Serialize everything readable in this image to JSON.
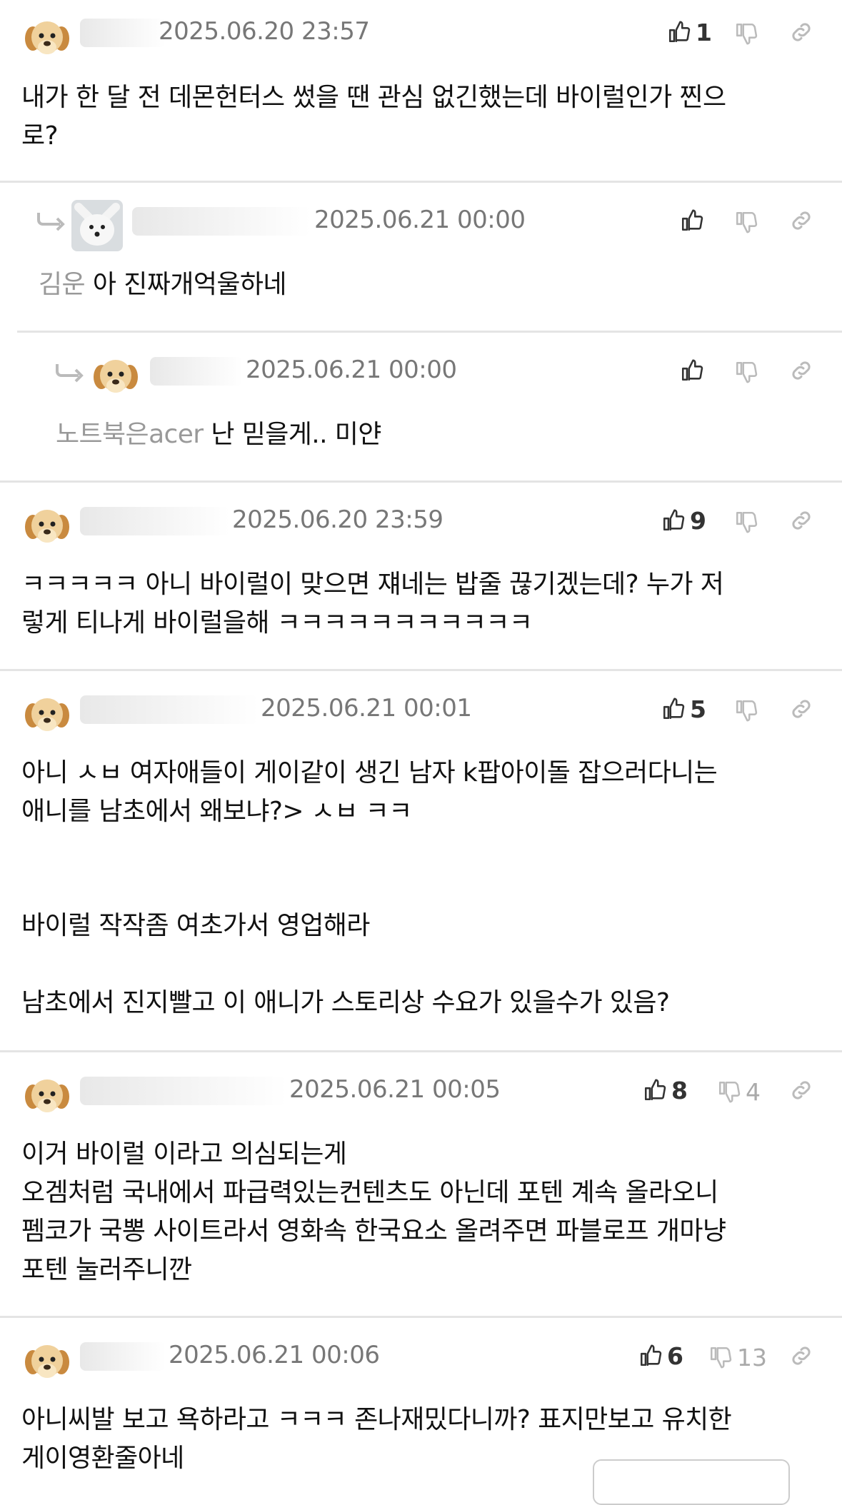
{
  "comments": [
    {
      "date": "2025.06.20 23:57",
      "likes": "1",
      "dislikes": "",
      "mention": "",
      "text_lines": [
        "내가 한 달 전 데몬헌터스 썼을 땐 관심 없긴했는데 바이럴인가 찐으",
        "로?"
      ]
    },
    {
      "date": "2025.06.21 00:00",
      "likes": "",
      "dislikes": "",
      "mention": "김운",
      "text_lines": [
        "아 진짜개억울하네"
      ]
    },
    {
      "date": "2025.06.21 00:00",
      "likes": "",
      "dislikes": "",
      "mention": "노트북은acer",
      "text_lines": [
        "난 믿을게.. 미얀"
      ]
    },
    {
      "date": "2025.06.20 23:59",
      "likes": "9",
      "dislikes": "",
      "mention": "",
      "text_lines": [
        "ㅋㅋㅋㅋㅋ 아니 바이럴이 맞으면 쟤네는 밥줄 끊기겠는데? 누가 저",
        "렇게 티나게 바이럴을해 ㅋㅋㅋㅋㅋㅋㅋㅋㅋㅋㅋ"
      ]
    },
    {
      "date": "2025.06.21 00:01",
      "likes": "5",
      "dislikes": "",
      "mention": "",
      "text_lines": [
        "아니 ㅅㅂ 여자애들이 게이같이 생긴 남자 k팝아이돌 잡으러다니는",
        "애니를 남초에서 왜보냐?> ㅅㅂ ㅋㅋ",
        "",
        "",
        "바이럴 작작좀 여초가서 영업해라",
        "",
        "남초에서 진지빨고 이 애니가 스토리상 수요가 있을수가 있음?"
      ]
    },
    {
      "date": "2025.06.21 00:05",
      "likes": "8",
      "dislikes": "4",
      "mention": "",
      "text_lines": [
        "이거 바이럴 이라고 의심되는게",
        "오겜처럼 국내에서 파급력있는컨텐츠도 아닌데 포텐 계속 올라오니",
        "펨코가 국뽕 사이트라서 영화속 한국요소 올려주면 파블로프 개마냥",
        "포텐 눌러주니깐"
      ]
    },
    {
      "date": "2025.06.21 00:06",
      "likes": "6",
      "dislikes": "13",
      "mention": "",
      "text_lines": [
        "아니씨발 보고 욕하라고 ㅋㅋㅋ 존나재밌다니까? 표지만보고 유치한",
        "게이영환줄아네"
      ]
    }
  ],
  "icons": {
    "like": "thumbs-up-icon",
    "dislike": "thumbs-down-icon",
    "link": "link-icon",
    "reply": "reply-arrow-icon",
    "avatar_dog": "puppy-avatar",
    "avatar_fox": "white-fox-avatar"
  },
  "colors": {
    "text": "#111111",
    "date": "#777777",
    "mention": "#999999",
    "separator": "#e4e4e4"
  }
}
